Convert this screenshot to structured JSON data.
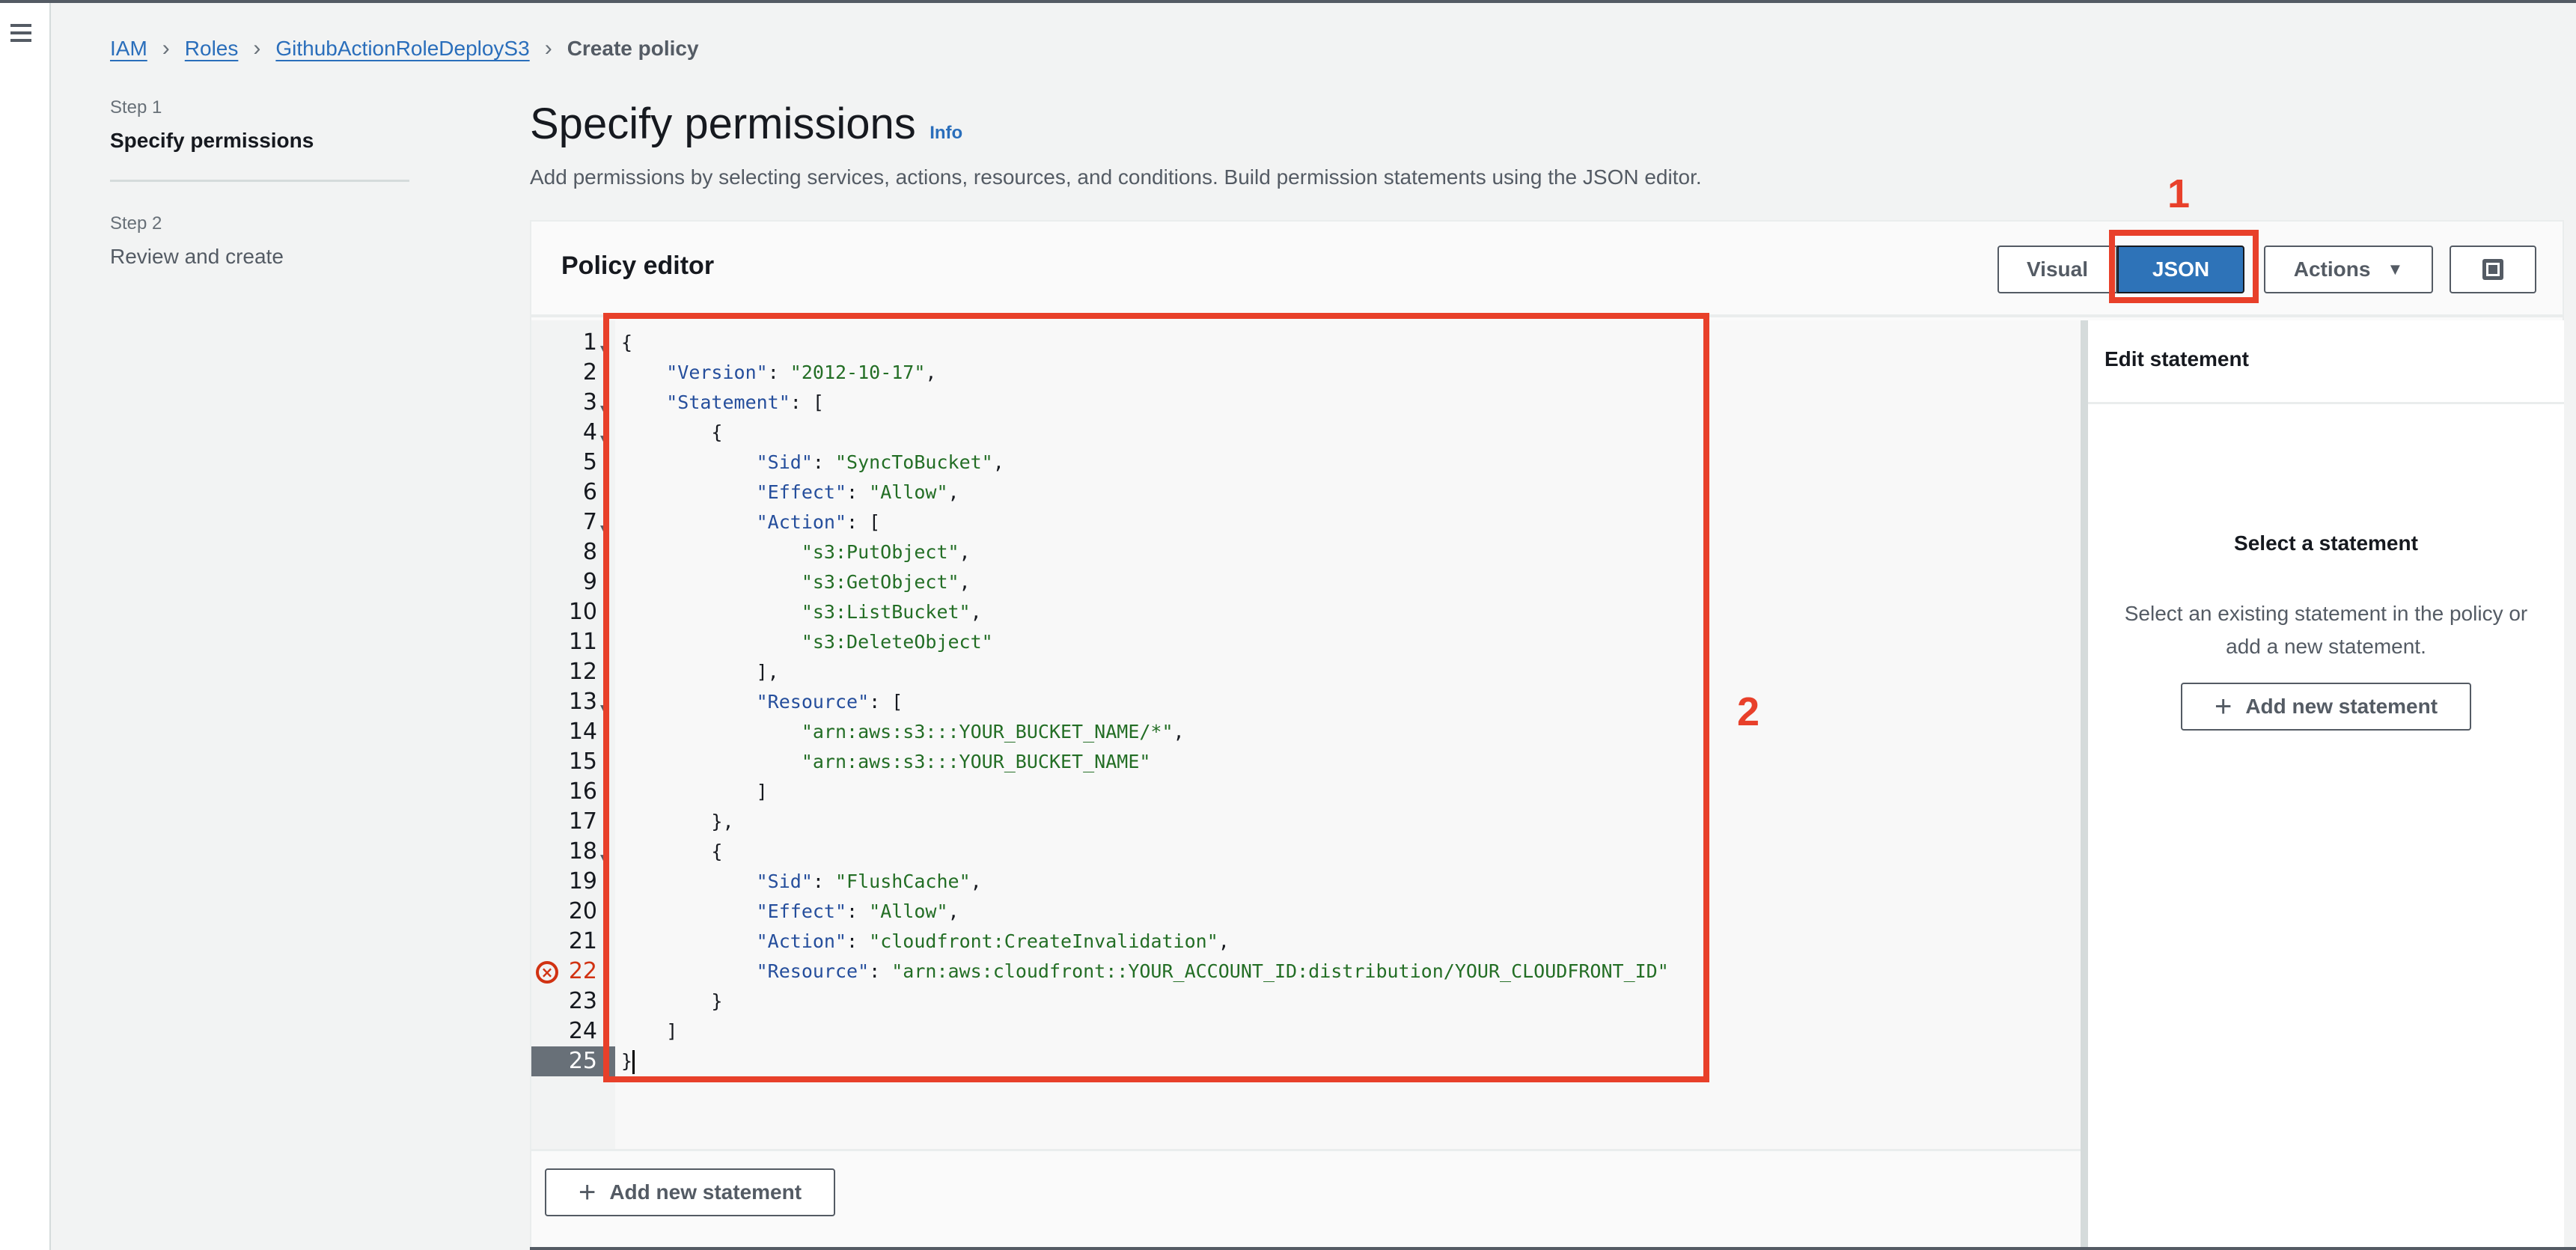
{
  "nav": {
    "menu_icon": "hamburger-menu-icon"
  },
  "breadcrumb": {
    "items": [
      {
        "label": "IAM",
        "link": true
      },
      {
        "label": "Roles",
        "link": true
      },
      {
        "label": "GithubActionRoleDeployS3",
        "link": true
      },
      {
        "label": "Create policy",
        "link": false
      }
    ],
    "separator": "›"
  },
  "steps": [
    {
      "step": "Step 1",
      "title": "Specify permissions",
      "active": true
    },
    {
      "step": "Step 2",
      "title": "Review and create",
      "active": false
    }
  ],
  "header": {
    "title": "Specify permissions",
    "info": "Info",
    "description": "Add permissions by selecting services, actions, resources, and conditions. Build permission statements using the JSON editor."
  },
  "editor": {
    "title": "Policy editor",
    "modes": {
      "visual": "Visual",
      "json": "JSON",
      "selected": "JSON"
    },
    "actions_label": "Actions",
    "actions_caret": "▼",
    "panel_toggle_icon": "split-panel-icon",
    "active_line": 25,
    "error_lines": [
      22
    ],
    "fold_lines": [
      1,
      3,
      4,
      7,
      13,
      18
    ],
    "lines": [
      [
        {
          "t": "p",
          "v": "{"
        }
      ],
      [
        {
          "t": "p",
          "v": "    "
        },
        {
          "t": "k",
          "v": "\"Version\""
        },
        {
          "t": "p",
          "v": ": "
        },
        {
          "t": "s",
          "v": "\"2012-10-17\""
        },
        {
          "t": "p",
          "v": ","
        }
      ],
      [
        {
          "t": "p",
          "v": "    "
        },
        {
          "t": "k",
          "v": "\"Statement\""
        },
        {
          "t": "p",
          "v": ": ["
        }
      ],
      [
        {
          "t": "p",
          "v": "        {"
        }
      ],
      [
        {
          "t": "p",
          "v": "            "
        },
        {
          "t": "k",
          "v": "\"Sid\""
        },
        {
          "t": "p",
          "v": ": "
        },
        {
          "t": "s",
          "v": "\"SyncToBucket\""
        },
        {
          "t": "p",
          "v": ","
        }
      ],
      [
        {
          "t": "p",
          "v": "            "
        },
        {
          "t": "k",
          "v": "\"Effect\""
        },
        {
          "t": "p",
          "v": ": "
        },
        {
          "t": "s",
          "v": "\"Allow\""
        },
        {
          "t": "p",
          "v": ","
        }
      ],
      [
        {
          "t": "p",
          "v": "            "
        },
        {
          "t": "k",
          "v": "\"Action\""
        },
        {
          "t": "p",
          "v": ": ["
        }
      ],
      [
        {
          "t": "p",
          "v": "                "
        },
        {
          "t": "s",
          "v": "\"s3:PutObject\""
        },
        {
          "t": "p",
          "v": ","
        }
      ],
      [
        {
          "t": "p",
          "v": "                "
        },
        {
          "t": "s",
          "v": "\"s3:GetObject\""
        },
        {
          "t": "p",
          "v": ","
        }
      ],
      [
        {
          "t": "p",
          "v": "                "
        },
        {
          "t": "s",
          "v": "\"s3:ListBucket\""
        },
        {
          "t": "p",
          "v": ","
        }
      ],
      [
        {
          "t": "p",
          "v": "                "
        },
        {
          "t": "s",
          "v": "\"s3:DeleteObject\""
        }
      ],
      [
        {
          "t": "p",
          "v": "            ],"
        }
      ],
      [
        {
          "t": "p",
          "v": "            "
        },
        {
          "t": "k",
          "v": "\"Resource\""
        },
        {
          "t": "p",
          "v": ": ["
        }
      ],
      [
        {
          "t": "p",
          "v": "                "
        },
        {
          "t": "s",
          "v": "\"arn:aws:s3:::YOUR_BUCKET_NAME/*\""
        },
        {
          "t": "p",
          "v": ","
        }
      ],
      [
        {
          "t": "p",
          "v": "                "
        },
        {
          "t": "s",
          "v": "\"arn:aws:s3:::YOUR_BUCKET_NAME\""
        }
      ],
      [
        {
          "t": "p",
          "v": "            ]"
        }
      ],
      [
        {
          "t": "p",
          "v": "        },"
        }
      ],
      [
        {
          "t": "p",
          "v": "        {"
        }
      ],
      [
        {
          "t": "p",
          "v": "            "
        },
        {
          "t": "k",
          "v": "\"Sid\""
        },
        {
          "t": "p",
          "v": ": "
        },
        {
          "t": "s",
          "v": "\"FlushCache\""
        },
        {
          "t": "p",
          "v": ","
        }
      ],
      [
        {
          "t": "p",
          "v": "            "
        },
        {
          "t": "k",
          "v": "\"Effect\""
        },
        {
          "t": "p",
          "v": ": "
        },
        {
          "t": "s",
          "v": "\"Allow\""
        },
        {
          "t": "p",
          "v": ","
        }
      ],
      [
        {
          "t": "p",
          "v": "            "
        },
        {
          "t": "k",
          "v": "\"Action\""
        },
        {
          "t": "p",
          "v": ": "
        },
        {
          "t": "s",
          "v": "\"cloudfront:CreateInvalidation\""
        },
        {
          "t": "p",
          "v": ","
        }
      ],
      [
        {
          "t": "p",
          "v": "            "
        },
        {
          "t": "k",
          "v": "\"Resource\""
        },
        {
          "t": "p",
          "v": ": "
        },
        {
          "t": "s",
          "v": "\"arn:aws:cloudfront::YOUR_ACCOUNT_ID:distribution/YOUR_CLOUDFRONT_ID\""
        }
      ],
      [
        {
          "t": "p",
          "v": "        }"
        }
      ],
      [
        {
          "t": "p",
          "v": "    ]"
        }
      ],
      [
        {
          "t": "p",
          "v": "}"
        }
      ]
    ],
    "add_statement_label": "Add new statement"
  },
  "side_panel": {
    "title": "Edit statement",
    "empty_title": "Select a statement",
    "empty_desc": "Select an existing statement in the policy or add a new statement.",
    "add_label": "Add new statement"
  },
  "annotations": [
    {
      "label": "1",
      "target": "JSON button"
    },
    {
      "label": "2",
      "target": "JSON code area"
    }
  ],
  "colors": {
    "accent_blue": "#2e73b8",
    "link_blue": "#2a6ebb",
    "annotation_red": "#e8402a",
    "error_red": "#d13212",
    "json_key": "#254e9c",
    "json_string": "#236e25"
  }
}
